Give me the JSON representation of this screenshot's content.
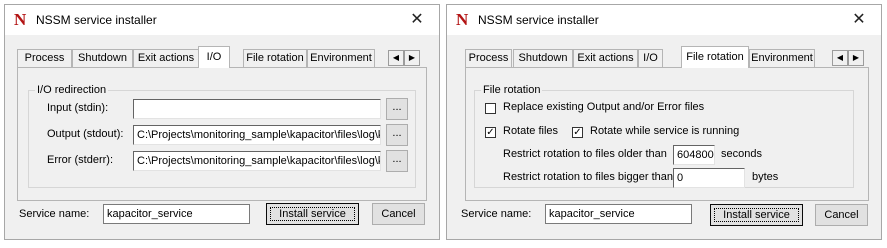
{
  "windows": [
    {
      "title": "NSSM service installer",
      "app_icon_glyph": "N",
      "close_glyph": "✕",
      "tabs": [
        "Process",
        "Shutdown",
        "Exit actions",
        "I/O",
        "File rotation",
        "Environment"
      ],
      "active_tab": "I/O",
      "scroll_left_glyph": "◀",
      "scroll_right_glyph": "▶",
      "io": {
        "group_title": "I/O redirection",
        "input_label": "Input (stdin):",
        "input_value": "",
        "output_label": "Output (stdout):",
        "output_value": "C:\\Projects\\monitoring_sample\\kapacitor\\files\\log\\k",
        "error_label": "Error (stderr):",
        "error_value": "C:\\Projects\\monitoring_sample\\kapacitor\\files\\log\\k",
        "browse_label": "..."
      },
      "service_name_label": "Service name:",
      "service_name_value": "kapacitor_service",
      "install_label": "Install service",
      "cancel_label": "Cancel"
    },
    {
      "title": "NSSM service installer",
      "app_icon_glyph": "N",
      "close_glyph": "✕",
      "tabs": [
        "Process",
        "Shutdown",
        "Exit actions",
        "I/O",
        "File rotation",
        "Environment"
      ],
      "active_tab": "File rotation",
      "scroll_left_glyph": "◀",
      "scroll_right_glyph": "▶",
      "rotation": {
        "group_title": "File rotation",
        "replace_label": "Replace existing Output and/or Error files",
        "replace_checked": false,
        "rotate_label": "Rotate files",
        "rotate_checked": true,
        "online_label": "Rotate while service is running",
        "online_checked": true,
        "older_label": "Restrict rotation to files older than",
        "older_value": "604800",
        "older_unit": "seconds",
        "bigger_label": "Restrict rotation to files bigger than",
        "bigger_value": "0",
        "bigger_unit": "bytes",
        "check_glyph": "✓"
      },
      "service_name_label": "Service name:",
      "service_name_value": "kapacitor_service",
      "install_label": "Install service",
      "cancel_label": "Cancel"
    }
  ]
}
